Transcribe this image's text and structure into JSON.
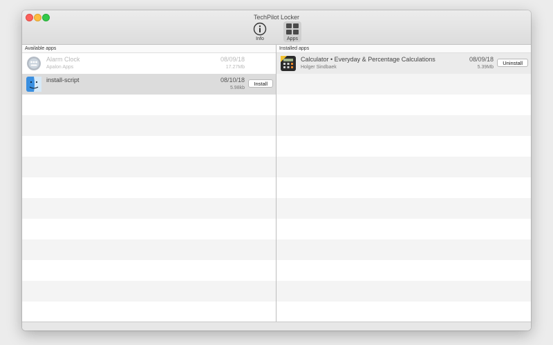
{
  "window": {
    "title": "TechPilot Locker"
  },
  "toolbar": {
    "info_label": "Info",
    "apps_label": "Apps"
  },
  "available": {
    "header": "Available apps",
    "items": [
      {
        "name": "Alarm Clock",
        "publisher": "Apalon Apps",
        "date": "08/09/18",
        "size": "17.27Mb",
        "state": "disabled",
        "icon": "alarm-clock-app-icon"
      },
      {
        "name": "install-script",
        "publisher": "",
        "date": "08/10/18",
        "size": "5.98kb",
        "state": "selected",
        "button": "Install",
        "icon": "finder-app-icon"
      }
    ]
  },
  "installed": {
    "header": "Installed apps",
    "items": [
      {
        "name": "Calculator • Everyday & Percentage Calculations",
        "publisher": "Holger Sindbaek",
        "date": "08/09/18",
        "size": "5.39Mb",
        "button": "Uninstall",
        "icon": "calculator-app-icon"
      }
    ]
  },
  "colors": {
    "selected_row": "#dcdcdc",
    "stripe": "#f4f4f4"
  }
}
